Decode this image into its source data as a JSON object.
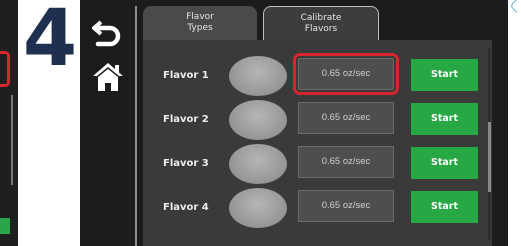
{
  "step_number": "4",
  "tabs": [
    {
      "line1": "Flavor",
      "line2": "Types"
    },
    {
      "line1": "Calibrate",
      "line2": "Flavors"
    }
  ],
  "nav": {
    "back_icon": "back-arrow-icon",
    "home_icon": "home-icon"
  },
  "rows": [
    {
      "label": "Flavor 1",
      "rate": "0.65 oz/sec",
      "start": "Start"
    },
    {
      "label": "Flavor 2",
      "rate": "0.65 oz/sec",
      "start": "Start"
    },
    {
      "label": "Flavor 3",
      "rate": "0.65 oz/sec",
      "start": "Start"
    },
    {
      "label": "Flavor 4",
      "rate": "0.65 oz/sec",
      "start": "Start"
    }
  ],
  "colors": {
    "screen_bg": "#1c1c1c",
    "content_bg": "#3a3a3a",
    "start_green": "#28a745",
    "highlight_red": "#d7262d",
    "step_number": "#1f2f4f"
  }
}
